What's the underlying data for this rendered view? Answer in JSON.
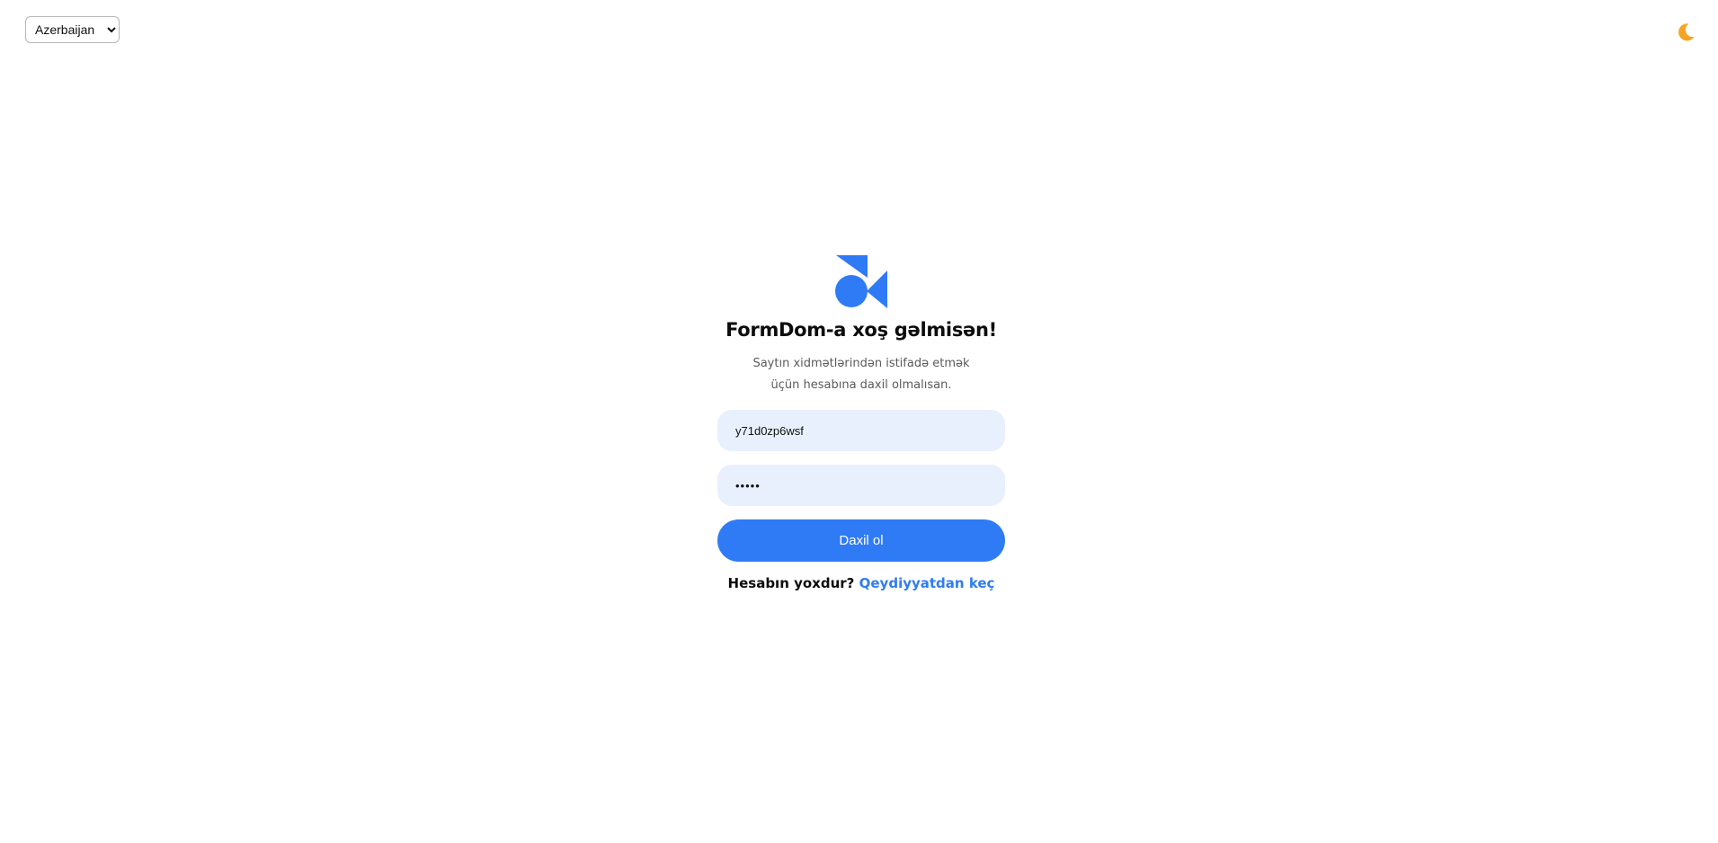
{
  "language_select": {
    "selected": "Azerbaijan"
  },
  "theme_toggle": {
    "icon": "crescent-moon-icon"
  },
  "login": {
    "logo_icon": "formdom-logo",
    "title": "FormDom-a xoş gəlmisən!",
    "subtitle": "Saytın xidmətlərindən istifadə etmək üçün hesabına daxil olmalısan.",
    "username_value": "y71d0zp6wsf",
    "password_value": "•••••",
    "submit_label": "Daxil ol",
    "register_prompt": "Hesabın yoxdur?",
    "register_link": "Qeydiyyatdan keç"
  },
  "colors": {
    "accent": "#2f7bf5",
    "input_background": "#e8f0fd",
    "moon": "#f5a524"
  }
}
